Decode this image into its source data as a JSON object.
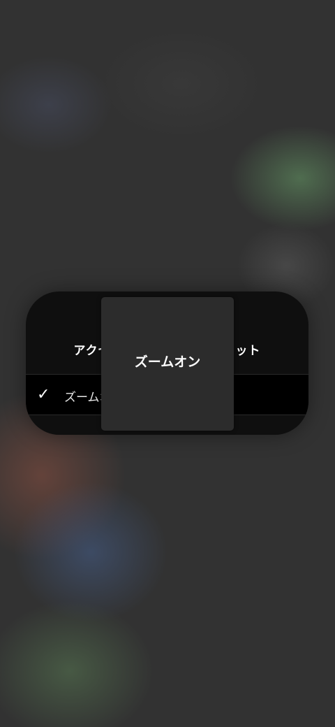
{
  "panel": {
    "title": "アクセシビリティショートカット",
    "items": [
      {
        "label": "ズームオン",
        "checked": true,
        "check_icon": "checkmark-icon"
      }
    ]
  },
  "toast": {
    "label": "ズームオン"
  },
  "colors": {
    "background": "#323232",
    "panel": "#0f0f0f",
    "row": "#000000",
    "toast": "#2c2c2c",
    "text": "#ffffff"
  }
}
